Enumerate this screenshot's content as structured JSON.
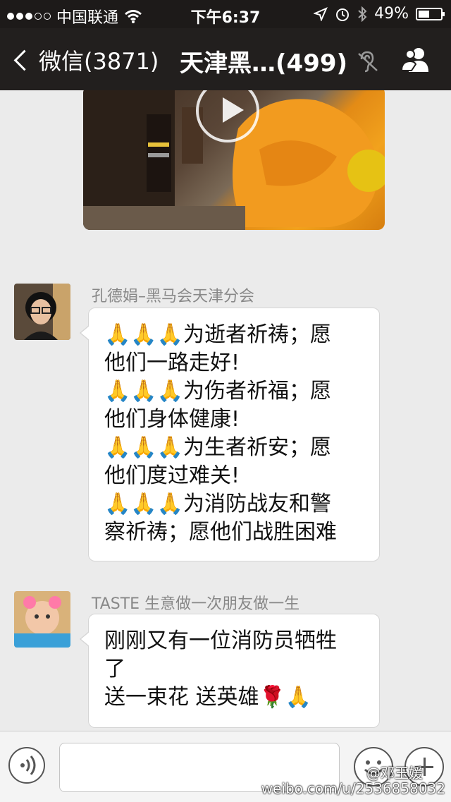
{
  "status_bar": {
    "carrier": "中国联通",
    "time": "下午6:37",
    "battery": "49%",
    "battery_level": 0.49
  },
  "nav": {
    "back_label": "微信(3871)",
    "title": "天津黑…(499)",
    "mute_icon": "ear-muted-icon",
    "contacts_icon": "group-contacts-icon"
  },
  "messages": [
    {
      "type": "video",
      "play_icon": "play-icon"
    },
    {
      "sender": "孔德娟–黑马会天津分会",
      "lines": [
        "🙏🙏🙏为逝者祈祷；愿",
        "他们一路走好!",
        "🙏🙏🙏为伤者祈福；愿",
        "他们身体健康!",
        "🙏🙏🙏为生者祈安；愿",
        "他们度过难关!",
        "🙏🙏🙏为消防战友和警",
        "察祈祷；愿他们战胜困难"
      ]
    },
    {
      "sender": "TASTE 生意做一次朋友做一生",
      "lines": [
        "刚刚又有一位消防员牺牲",
        "了",
        "送一束花 送英雄🌹🙏"
      ]
    }
  ],
  "input_bar": {
    "voice_icon": "voice-icon",
    "emoji_icon": "emoji-icon",
    "plus_icon": "plus-icon"
  },
  "watermark": {
    "user": "@邓玉媛",
    "url": "weibo.com/u/2536858032"
  }
}
